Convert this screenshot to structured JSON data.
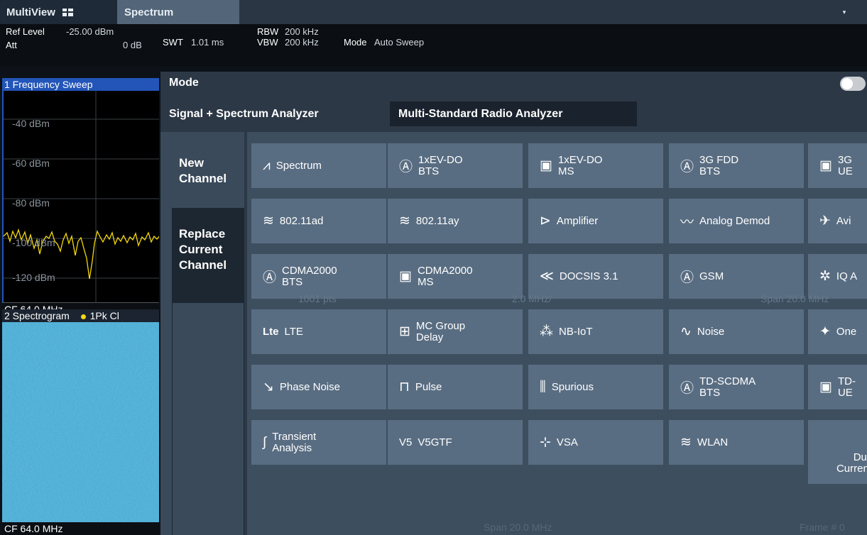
{
  "app": {
    "tab_multiview": "MultiView",
    "tab_spectrum": "Spectrum",
    "dropdown_icon": "▾"
  },
  "info": {
    "ref_level_label": "Ref Level",
    "ref_level_value": "-25.00 dBm",
    "att_label": "Att",
    "att_value": "0 dB",
    "swt_label": "SWT",
    "swt_value": "1.01 ms",
    "rbw_label": "RBW",
    "rbw_value": "200 kHz",
    "vbw_label": "VBW",
    "vbw_value": "200 kHz",
    "mode_label": "Mode",
    "mode_value": "Auto Sweep"
  },
  "window1": {
    "title": "1 Frequency Sweep",
    "y_labels": [
      "-40 dBm",
      "-60 dBm",
      "-80 dBm",
      "-100 dBm",
      "-120 dBm"
    ],
    "footer": "CF 64.0 MHz"
  },
  "window2": {
    "title": "2 Spectrogram",
    "trace": "1Pk Cl",
    "footer": "CF 64.0 MHz"
  },
  "dialog": {
    "title": "Mode",
    "tabs": [
      "Signal + Spectrum Analyzer",
      "Multi-Standard Radio Analyzer"
    ],
    "side": {
      "new_channel": "New\nChannel",
      "replace_channel": "Replace\nCurrent\nChannel"
    },
    "tiles": [
      {
        "label": "Spectrum",
        "icon": "spectrum-icon"
      },
      {
        "label": "1xEV-DO\nBTS",
        "icon": "bts-do-icon"
      },
      {
        "label": "1xEV-DO\nMS",
        "icon": "ms-do-icon"
      },
      {
        "label": "3G FDD\nBTS",
        "icon": "bts-3g-icon"
      },
      {
        "label": "3G\nUE",
        "icon": "ue-3g-icon"
      },
      {
        "label": "802.11ad",
        "icon": "wifi-icon"
      },
      {
        "label": "802.11ay",
        "icon": "wifi-icon"
      },
      {
        "label": "Amplifier",
        "icon": "amplifier-icon"
      },
      {
        "label": "Analog Demod",
        "icon": "analog-demod-icon"
      },
      {
        "label": "Avi",
        "icon": "airplane-icon"
      },
      {
        "label": "CDMA2000\nBTS",
        "icon": "bts-c2k-icon"
      },
      {
        "label": "CDMA2000\nMS",
        "icon": "ms-c2k-icon"
      },
      {
        "label": "DOCSIS 3.1",
        "icon": "docsis-icon"
      },
      {
        "label": "GSM",
        "icon": "gsm-icon"
      },
      {
        "label": "IQ A",
        "icon": "iq-icon"
      },
      {
        "label": "LTE",
        "icon": "lte-icon"
      },
      {
        "label": "MC Group\nDelay",
        "icon": "mc-group-delay-icon"
      },
      {
        "label": "NB-IoT",
        "icon": "nbiot-icon"
      },
      {
        "label": "Noise",
        "icon": "noise-icon"
      },
      {
        "label": "One",
        "icon": "satellite-icon"
      },
      {
        "label": "Phase Noise",
        "icon": "phase-noise-icon"
      },
      {
        "label": "Pulse",
        "icon": "pulse-icon"
      },
      {
        "label": "Spurious",
        "icon": "spurious-icon"
      },
      {
        "label": "TD-SCDMA\nBTS",
        "icon": "bts-td-icon"
      },
      {
        "label": "TD-\nUE",
        "icon": "ue-td-icon"
      },
      {
        "label": "Transient\nAnalysis",
        "icon": "transient-icon"
      },
      {
        "label": "V5GTF",
        "icon": "v5gtf-icon"
      },
      {
        "label": "VSA",
        "icon": "vsa-icon"
      },
      {
        "label": "WLAN",
        "icon": "wifi-icon"
      },
      {
        "label": "Duplicate\nCurrent Channel",
        "icon": "duplicate-icon"
      }
    ],
    "background_text": {
      "pts": "1001 pts",
      "mhz": "2.0 MHz/",
      "span1": "Span 20.0 MHz",
      "span2": "Span 20.0 MHz",
      "frame": "Frame # 0"
    }
  },
  "colors": {
    "accent": "#2355b8",
    "tile": "#596d82",
    "dialog_bg": "#3a4a5a",
    "trace": "#f5d90c"
  }
}
